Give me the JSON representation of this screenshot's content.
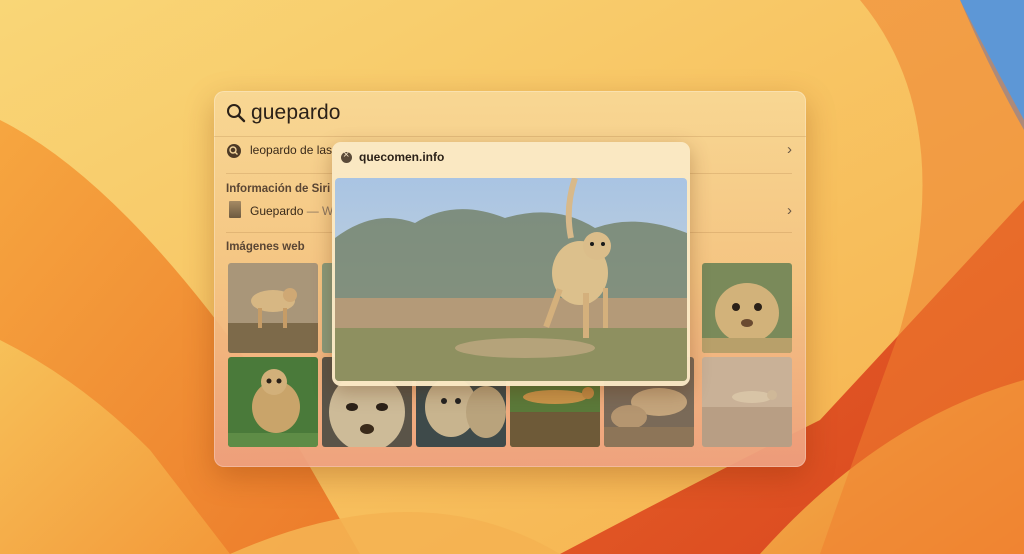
{
  "search": {
    "query": "guepardo"
  },
  "suggestion": {
    "text": "leopardo de las"
  },
  "siri_section": {
    "title": "Información de Siri",
    "item_title": "Guepardo",
    "item_sub": "— W"
  },
  "web_images": {
    "title": "Imágenes web"
  },
  "preview": {
    "source": "quecomen.info"
  },
  "icons": [
    "search-icon",
    "magnifier-suggestion-icon",
    "chevron-right-icon",
    "close-icon"
  ]
}
